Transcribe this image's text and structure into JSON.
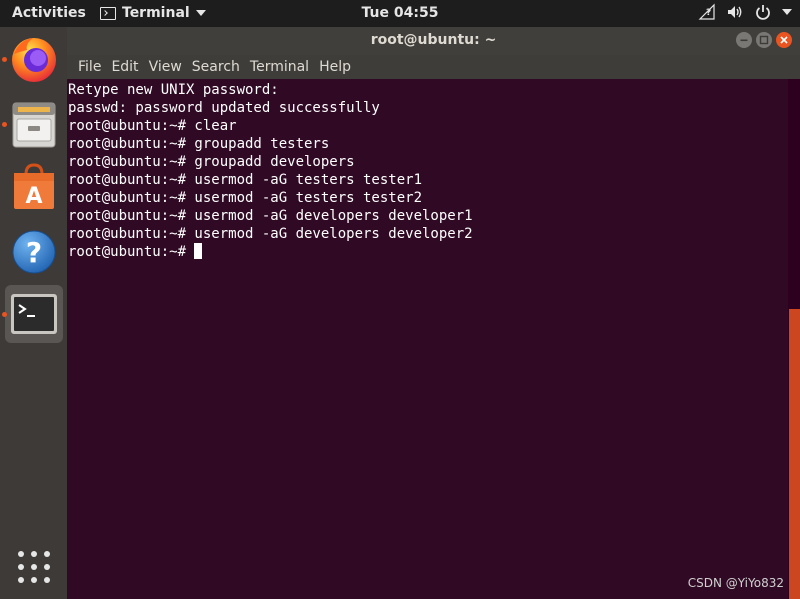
{
  "topbar": {
    "activities": "Activities",
    "app_name": "Terminal",
    "clock": "Tue 04:55"
  },
  "dock": {
    "items": [
      {
        "name": "Firefox",
        "icon": "firefox-icon",
        "running": true
      },
      {
        "name": "Files",
        "icon": "file-cabinet-icon",
        "running": true
      },
      {
        "name": "Ubuntu Software",
        "icon": "shopping-bag-icon",
        "running": false
      },
      {
        "name": "Help",
        "icon": "help-icon",
        "running": false
      },
      {
        "name": "Terminal",
        "icon": "terminal-icon",
        "running": true,
        "active": true
      }
    ],
    "apps_grid_icon": "apps-grid-icon"
  },
  "window": {
    "title": "root@ubuntu: ~",
    "menu": [
      "File",
      "Edit",
      "View",
      "Search",
      "Terminal",
      "Help"
    ]
  },
  "terminal": {
    "lines": [
      "Retype new UNIX password:",
      "passwd: password updated successfully",
      "root@ubuntu:~# clear",
      "root@ubuntu:~# groupadd testers",
      "root@ubuntu:~# groupadd developers",
      "root@ubuntu:~# usermod -aG testers tester1",
      "root@ubuntu:~# usermod -aG testers tester2",
      "root@ubuntu:~# usermod -aG developers developer1",
      "root@ubuntu:~# usermod -aG developers developer2"
    ],
    "prompt": "root@ubuntu:~# "
  },
  "watermark": "CSDN @YiYo832",
  "colors": {
    "terminal_bg": "#300a24",
    "accent": "#e95420",
    "topbar_bg": "#1d1d1d",
    "dock_bg": "#3d3a38"
  }
}
